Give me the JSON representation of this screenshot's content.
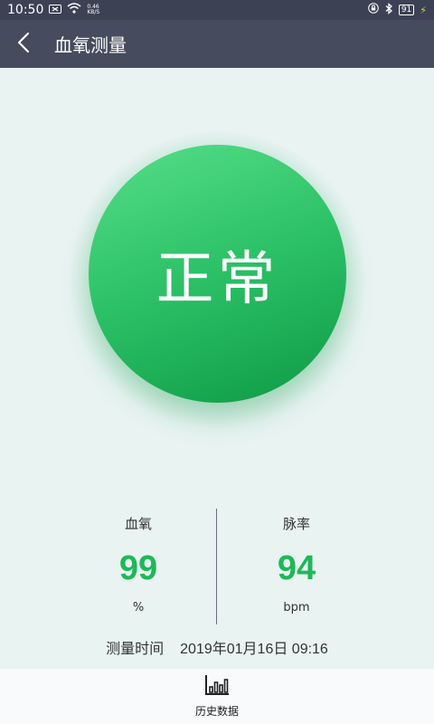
{
  "status_bar": {
    "time": "10:50",
    "network_speed_value": "0.46",
    "network_speed_unit": "KB/S",
    "battery": "91"
  },
  "header": {
    "title": "血氧测量"
  },
  "result": {
    "status": "正常"
  },
  "metrics": {
    "spo2": {
      "label": "血氧",
      "value": "99",
      "unit": "%"
    },
    "pulse": {
      "label": "脉率",
      "value": "94",
      "unit": "bpm"
    }
  },
  "measurement": {
    "time_label": "测量时间",
    "time_value": "2019年01月16日 09:16"
  },
  "bottom_nav": {
    "history_label": "历史数据"
  },
  "colors": {
    "header_bg": "#464c5e",
    "status_bar_bg": "#3c4254",
    "page_bg": "#e8f3f2",
    "accent_green": "#1fb858"
  }
}
